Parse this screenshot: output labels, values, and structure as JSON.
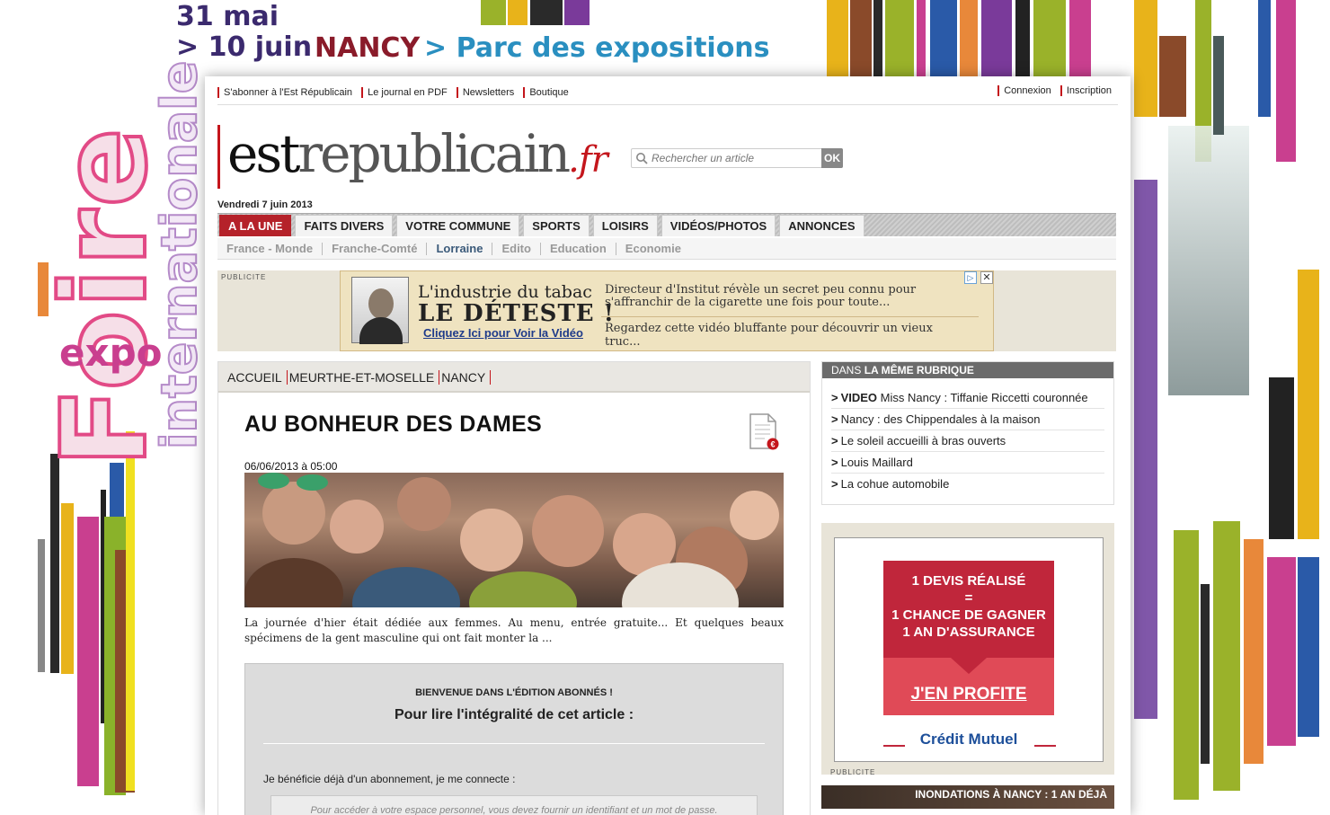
{
  "promo": {
    "date_line1": "31 mai",
    "date_line2": "> 10 juin",
    "city": "NANCY",
    "venue": "> Parc des expositions",
    "vertical_title": "Foire",
    "vertical_subtitle": "internationale",
    "expo_word": "expo"
  },
  "top_links": {
    "left": [
      "S'abonner à l'Est Républicain",
      "Le journal en PDF",
      "Newsletters",
      "Boutique"
    ],
    "right": [
      "Connexion",
      "Inscription"
    ]
  },
  "logo": {
    "part1": "est",
    "part2": "republicain",
    "part3": ".fr"
  },
  "search": {
    "placeholder": "Rechercher un article",
    "button": "OK"
  },
  "date": "Vendredi 7 juin 2013",
  "main_nav": [
    "A LA UNE",
    "FAITS DIVERS",
    "VOTRE COMMUNE",
    "SPORTS",
    "LOISIRS",
    "VIDÉOS/PHOTOS",
    "ANNONCES"
  ],
  "sub_nav": [
    "France - Monde",
    "Franche-Comté",
    "Lorraine",
    "Edito",
    "Education",
    "Economie"
  ],
  "top_ad": {
    "label": "PUBLICITE",
    "headline1": "L'industrie du tabac",
    "headline2": "LE DÉTESTE !",
    "cta": "Cliquez Ici pour Voir la Vidéo",
    "text1": "Directeur d'Institut révèle un secret peu connu pour s'affranchir de la cigarette une fois pour toute...",
    "text2": "Regardez cette vidéo bluffante pour découvrir un vieux truc...",
    "adchoice": "▷",
    "close": "✕"
  },
  "breadcrumb": [
    "ACCUEIL",
    "MEURTHE-ET-MOSELLE",
    "NANCY"
  ],
  "article": {
    "title": "AU BONHEUR DES DAMES",
    "date": "06/06/2013 à 05:00",
    "excerpt": "La journée d'hier était dédiée aux femmes. Au menu, entrée gratuite... Et quelques beaux spécimens de la gent masculine qui ont fait monter la ..."
  },
  "paywall": {
    "welcome": "BIENVENUE DANS L'ÉDITION ABONNÉS !",
    "headline": "Pour lire l'intégralité de cet article :",
    "subscriber": "Je bénéficie déjà d'un abonnement, je me connecte :",
    "login_hint": "Pour accéder à votre espace personnel, vous devez fournir un identifiant et un mot de passe."
  },
  "sidebar": {
    "rubrique_head_prefix": "DANS ",
    "rubrique_head_bold": "LA MÊME RUBRIQUE",
    "items": [
      {
        "tag": "VIDEO",
        "text": " Miss Nancy : Tiffanie Riccetti couronnée"
      },
      {
        "tag": "",
        "text": "Nancy : des Chippendales à la maison"
      },
      {
        "tag": "",
        "text": "Le soleil accueilli à bras ouverts"
      },
      {
        "tag": "",
        "text": "Louis Maillard"
      },
      {
        "tag": "",
        "text": "La cohue automobile"
      }
    ],
    "ad": {
      "line1": "1 DEVIS RÉALISÉ",
      "line2": "=",
      "line3": "1 CHANCE DE GAGNER",
      "line4": "1 AN D'ASSURANCE",
      "cta": "J'EN PROFITE",
      "brand": "Crédit Mutuel",
      "label": "PUBLICITE"
    },
    "flood_banner": "INONDATIONS À NANCY : 1 AN DÉJÀ"
  },
  "colors": {
    "accent_red": "#c4161c",
    "active_tab": "#b5222a",
    "sidebar_head": "#6b6b6b",
    "promo_purple": "#3b2a6e",
    "promo_blue": "#2a8fc0"
  }
}
